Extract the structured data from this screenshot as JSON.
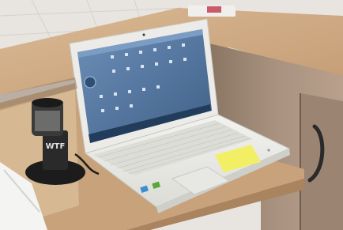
{
  "scene": {
    "subject": "laptop",
    "colors": {
      "wall": "#e6e2de",
      "desk_top": "#c9a27a",
      "desk_front": "#b48f6c",
      "cabinet": "#a58c79",
      "laptop_body": "#eeeeec",
      "screen_bg": "#5b7ea6",
      "sticky_note": "#f3ef64",
      "lamp": "#202020"
    },
    "lamp_label": "WTF"
  }
}
